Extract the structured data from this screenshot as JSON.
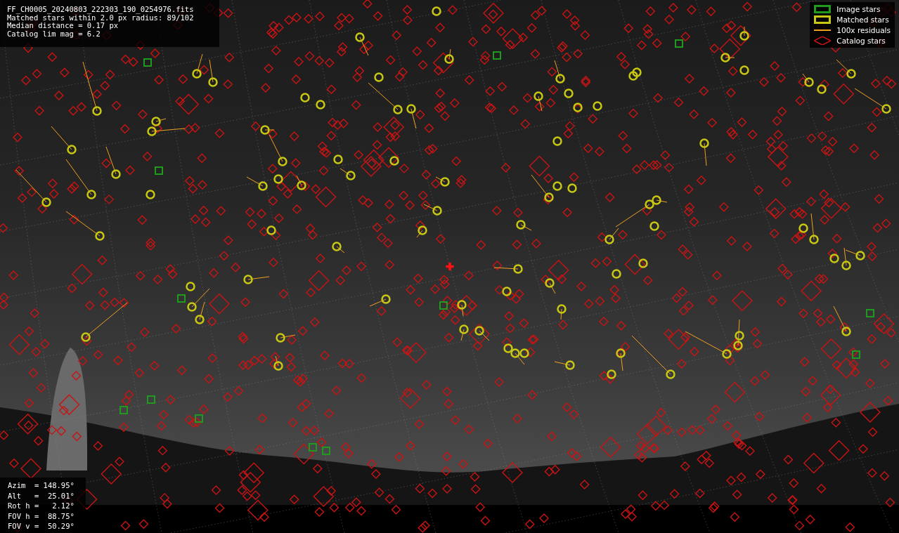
{
  "info_panel": {
    "lines": [
      "FF_CH0005_20240803_222303_190_0254976.fits",
      "Matched stars within 2.0 px radius: 89/102",
      "Median distance = 0.17 px",
      "Catalog lim mag = 6.2"
    ]
  },
  "legend": {
    "items": [
      {
        "kind": "square",
        "color": "#1f9a1f",
        "label": "Image stars"
      },
      {
        "kind": "square",
        "color": "#c8c814",
        "label": "Matched stars"
      },
      {
        "kind": "line",
        "color": "#f0a020",
        "label": "100x residuals"
      },
      {
        "kind": "diamond",
        "color": "#c81414",
        "label": "Catalog stars"
      }
    ]
  },
  "pointing_panel": {
    "lines": [
      "Azim  = 148.95°",
      "Alt   =  25.01°",
      "Rot h =   2.12°",
      "FOV h =  88.75°",
      "FOV v =  50.29°"
    ]
  }
}
